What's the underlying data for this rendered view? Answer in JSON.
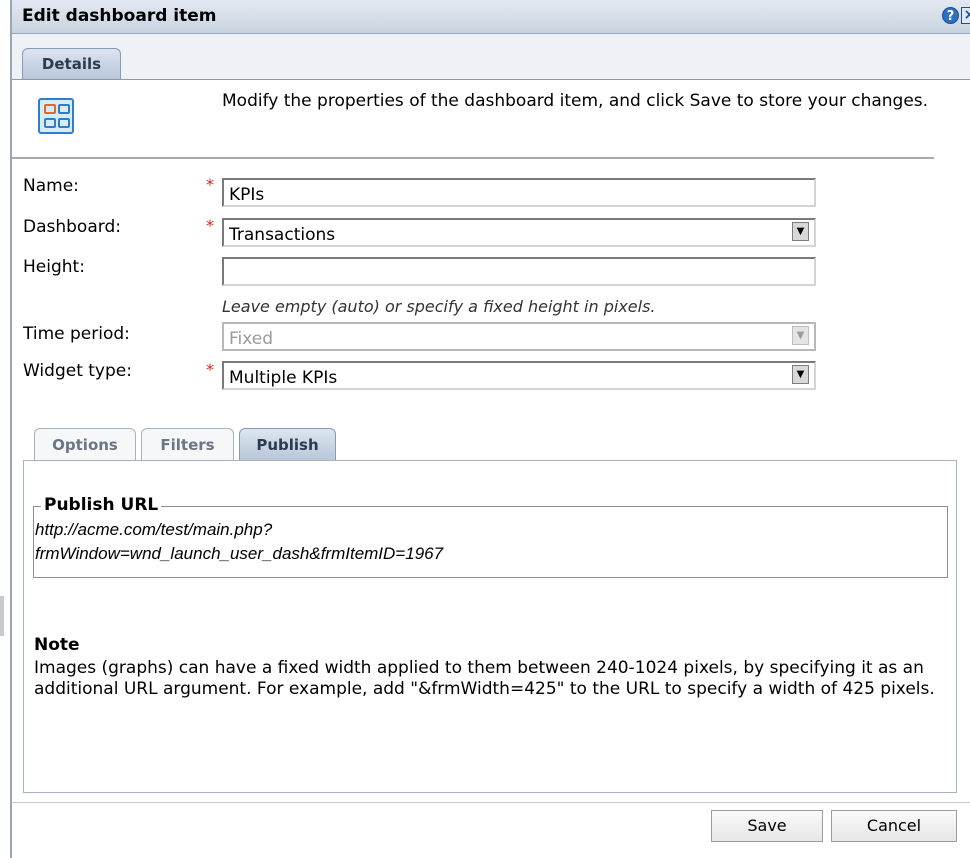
{
  "dialog": {
    "title": "Edit dashboard item",
    "help_glyph": "?",
    "close_glyph": "×"
  },
  "tabs": {
    "details": "Details"
  },
  "intro_text": "Modify the properties of the dashboard item, and click Save to store your changes.",
  "required_mark": "*",
  "form": {
    "name_label": "Name:",
    "name_value": "KPIs",
    "dashboard_label": "Dashboard:",
    "dashboard_value": "Transactions",
    "height_label": "Height:",
    "height_value": "",
    "height_hint": "Leave empty (auto) or specify a fixed height in pixels.",
    "time_period_label": "Time period:",
    "time_period_value": "Fixed",
    "widget_type_label": "Widget type:",
    "widget_type_value": "Multiple KPIs"
  },
  "subtabs": {
    "options": "Options",
    "filters": "Filters",
    "publish": "Publish",
    "active": "Publish"
  },
  "publish": {
    "legend": "Publish URL",
    "url_line1": "http://acme.com/test/main.php?",
    "url_line2": "frmWindow=wnd_launch_user_dash&frmItemID=1967"
  },
  "note": {
    "title": "Note",
    "text": "Images (graphs) can have a fixed width applied to them between 240-1024 pixels, by specifying it as an additional URL argument. For example, add \"&frmWidth=425\" to the URL to specify a width of 425 pixels."
  },
  "buttons": {
    "save": "Save",
    "cancel": "Cancel"
  },
  "dropdown_glyph": "▼",
  "colors": {
    "title_bar": "#c9d3e0",
    "required": "#e02020",
    "accent": "#2f7fc8"
  }
}
